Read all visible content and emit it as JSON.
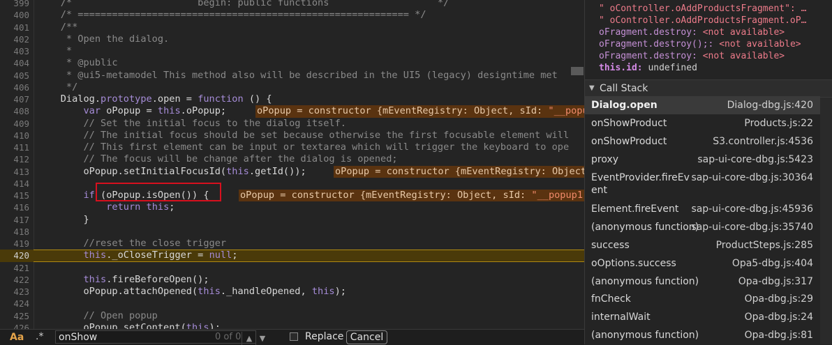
{
  "editor": {
    "lines": [
      {
        "num": "399",
        "code": "    /*                      begin: public functions                   */"
      },
      {
        "num": "400",
        "code": "    /* ========================================================== */"
      },
      {
        "num": "401",
        "code": "    /**"
      },
      {
        "num": "402",
        "code": "     * Open the dialog."
      },
      {
        "num": "403",
        "code": "     *"
      },
      {
        "num": "404",
        "code": "     * @public"
      },
      {
        "num": "405",
        "code": "     * @ui5-metamodel This method also will be described in the UI5 (legacy) designtime met"
      },
      {
        "num": "406",
        "code": "     */"
      },
      {
        "num": "407",
        "code": "    Dialog.prototype.open = function () {"
      },
      {
        "num": "408",
        "code": "        var oPopup = this.oPopup;"
      },
      {
        "num": "409",
        "code": "        // Set the initial focus to the dialog itself."
      },
      {
        "num": "410",
        "code": "        // The initial focus should be set because otherwise the first focusable element will"
      },
      {
        "num": "411",
        "code": "        // This first element can be input or textarea which will trigger the keyboard to ope"
      },
      {
        "num": "412",
        "code": "        // The focus will be change after the dialog is opened;"
      },
      {
        "num": "413",
        "code": "        oPopup.setInitialFocusId(this.getId());"
      },
      {
        "num": "414",
        "code": ""
      },
      {
        "num": "415",
        "code": "        if (oPopup.isOpen()) {"
      },
      {
        "num": "416",
        "code": "            return this;"
      },
      {
        "num": "417",
        "code": "        }"
      },
      {
        "num": "418",
        "code": ""
      },
      {
        "num": "419",
        "code": "        //reset the close trigger"
      },
      {
        "num": "420",
        "code": "        this._oCloseTrigger = null;"
      },
      {
        "num": "421",
        "code": ""
      },
      {
        "num": "422",
        "code": "        this.fireBeforeOpen();"
      },
      {
        "num": "423",
        "code": "        oPopup.attachOpened(this._handleOpened, this);"
      },
      {
        "num": "424",
        "code": ""
      },
      {
        "num": "425",
        "code": "        // Open popup"
      },
      {
        "num": "426",
        "code": "        oPopup.setContent(this);"
      }
    ],
    "inline_408": {
      "text": "oPopup = constructor {mEventRegistry: Object, sId: ",
      "str": "\"__popu"
    },
    "inline_413": {
      "text": "oPopup = constructor {mEventRegistry: Object"
    },
    "inline_415": {
      "text": "oPopup = constructor {mEventRegistry: Object, sId: ",
      "str": "\"__popup1"
    }
  },
  "watch": {
    "items": [
      {
        "key": "\" oController.oAddProductsFragment\": …",
        "type": "str"
      },
      {
        "key": "\" oController.oAddProductsFragment.oP…",
        "type": "str"
      },
      {
        "name": "oFragment.destroy:",
        "value": "<not available>"
      },
      {
        "name": "oFragment.destroy();:",
        "value": "<not available>"
      },
      {
        "name": "oFragment.destroy:",
        "value": "<not available>"
      },
      {
        "name": "this.id:",
        "value": "undefined"
      }
    ]
  },
  "callstack": {
    "header": "Call Stack",
    "frames": [
      {
        "fn": "Dialog.open",
        "loc": "Dialog-dbg.js:420",
        "active": true
      },
      {
        "fn": "onShowProduct",
        "loc": "Products.js:22"
      },
      {
        "fn": "onShowProduct",
        "loc": "S3.controller.js:4536"
      },
      {
        "fn": "proxy",
        "loc": "sap-ui-core-dbg.js:5423"
      },
      {
        "fn": "EventProvider.fireEvent",
        "loc": "sap-ui-core-dbg.js:30364"
      },
      {
        "fn": "Element.fireEvent",
        "loc": "sap-ui-core-dbg.js:45936"
      },
      {
        "fn": "(anonymous function)",
        "loc": "sap-ui-core-dbg.js:35740"
      },
      {
        "fn": "success",
        "loc": "ProductSteps.js:285"
      },
      {
        "fn": "oOptions.success",
        "loc": "Opa5-dbg.js:404"
      },
      {
        "fn": "(anonymous function)",
        "loc": "Opa-dbg.js:317"
      },
      {
        "fn": "fnCheck",
        "loc": "Opa-dbg.js:29"
      },
      {
        "fn": "internalWait",
        "loc": "Opa-dbg.js:24"
      },
      {
        "fn": "(anonymous function)",
        "loc": "Opa-dbg.js:81"
      }
    ]
  },
  "search": {
    "case_label": "Aa",
    "regex_label": ".*",
    "value": "onShow",
    "count": "0 of 0",
    "replace_label": "Replace",
    "cancel_label": "Cancel"
  }
}
